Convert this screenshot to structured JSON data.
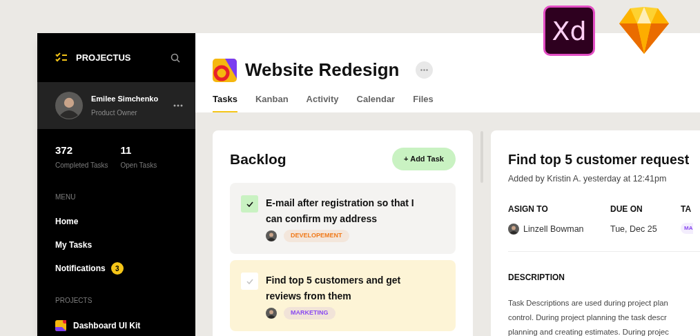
{
  "overlay_logos": {
    "xd_text": "Xd"
  },
  "sidebar": {
    "brand": "PROJECTUS",
    "user": {
      "name": "Emilee Simchenko",
      "role": "Product Owner"
    },
    "stats": [
      {
        "value": "372",
        "label": "Completed Tasks"
      },
      {
        "value": "11",
        "label": "Open Tasks"
      }
    ],
    "menu_heading": "MENU",
    "menu": [
      {
        "label": "Home"
      },
      {
        "label": "My Tasks"
      },
      {
        "label": "Notifications",
        "badge": "3"
      }
    ],
    "projects_heading": "PROJECTS",
    "projects": [
      {
        "label": "Dashboard UI Kit"
      }
    ]
  },
  "project": {
    "title": "Website Redesign"
  },
  "tabs": [
    {
      "label": "Tasks",
      "selected": true
    },
    {
      "label": "Kanban",
      "selected": false
    },
    {
      "label": "Activity",
      "selected": false
    },
    {
      "label": "Calendar",
      "selected": false
    },
    {
      "label": "Files",
      "selected": false
    }
  ],
  "backlog": {
    "title": "Backlog",
    "add_button": "+ Add Task",
    "tasks": [
      {
        "title": "E-mail after registration so that I can confirm my address",
        "checked": true,
        "highlighted": false,
        "tag": {
          "label": "DEVELOPEMENT",
          "color": "#f07a1a"
        }
      },
      {
        "title": "Find top 5 customers and get reviews from them",
        "checked": false,
        "highlighted": true,
        "tag": {
          "label": "MARKETING",
          "color": "#8a4bf0"
        }
      }
    ]
  },
  "detail": {
    "title": "Find top 5 customer request",
    "added": "Added by Kristin A. yesterday at 12:41pm",
    "fields": [
      {
        "kind": "person",
        "label": "ASIGN TO",
        "value": "Linzell Bowman"
      },
      {
        "kind": "text",
        "label": "DUE ON",
        "value": "Tue, Dec 25"
      },
      {
        "kind": "tag",
        "label": "TA",
        "value": "MA",
        "color": "#8a4bf0"
      }
    ],
    "description_heading": "DESCRIPTION",
    "description_lines": [
      "Task Descriptions are used during project plan",
      "control. During project planning the task descr",
      "planning and creating estimates. During projec"
    ]
  }
}
